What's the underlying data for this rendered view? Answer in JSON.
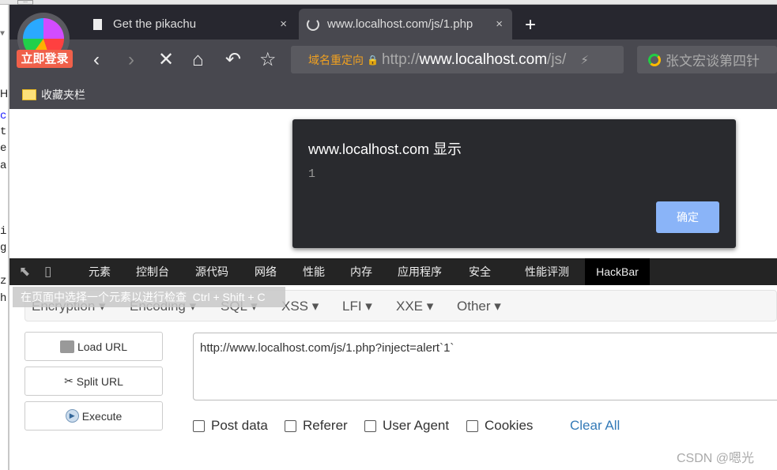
{
  "background": {
    "left_chars": [
      "▼",
      "He",
      "c",
      "t",
      "e",
      "a",
      "i",
      "g",
      "z",
      "h"
    ],
    "dots": "..."
  },
  "browser": {
    "login_badge": "立即登录",
    "tabs": [
      {
        "title": "Get the pikachu",
        "icon": "document-icon"
      },
      {
        "title": "www.localhost.com/js/1.php",
        "icon": "loading-icon",
        "active": true
      }
    ],
    "new_tab": "+",
    "tab_close": "×",
    "address": {
      "redirect_label": "域名重定向",
      "scheme": "http://",
      "host": "www.localhost.com",
      "path": "/js/"
    },
    "search_placeholder": "张文宏谈第四针",
    "bookmarks_folder": "收藏夹栏"
  },
  "dialog": {
    "title": "www.localhost.com 显示",
    "message": "1",
    "ok": "确定",
    "ok_color": "#8ab4f8"
  },
  "devtools": {
    "tabs": [
      "元素",
      "控制台",
      "源代码",
      "网络",
      "性能",
      "内存",
      "应用程序",
      "安全",
      "性能评测",
      "HackBar"
    ],
    "active": "HackBar",
    "tooltip": "在页面中选择一个元素以进行检查  Ctrl + Shift + C"
  },
  "hackbar": {
    "menus": [
      "Encryption",
      "Encoding",
      "SQL",
      "XSS",
      "LFI",
      "XXE",
      "Other"
    ],
    "buttons": [
      "Load URL",
      "Split URL",
      "Execute"
    ],
    "url": "http://www.localhost.com/js/1.php?inject=alert`1`",
    "options": [
      "Post data",
      "Referer",
      "User Agent",
      "Cookies"
    ],
    "clear_all": "Clear All"
  },
  "watermark": "CSDN @嗯光"
}
